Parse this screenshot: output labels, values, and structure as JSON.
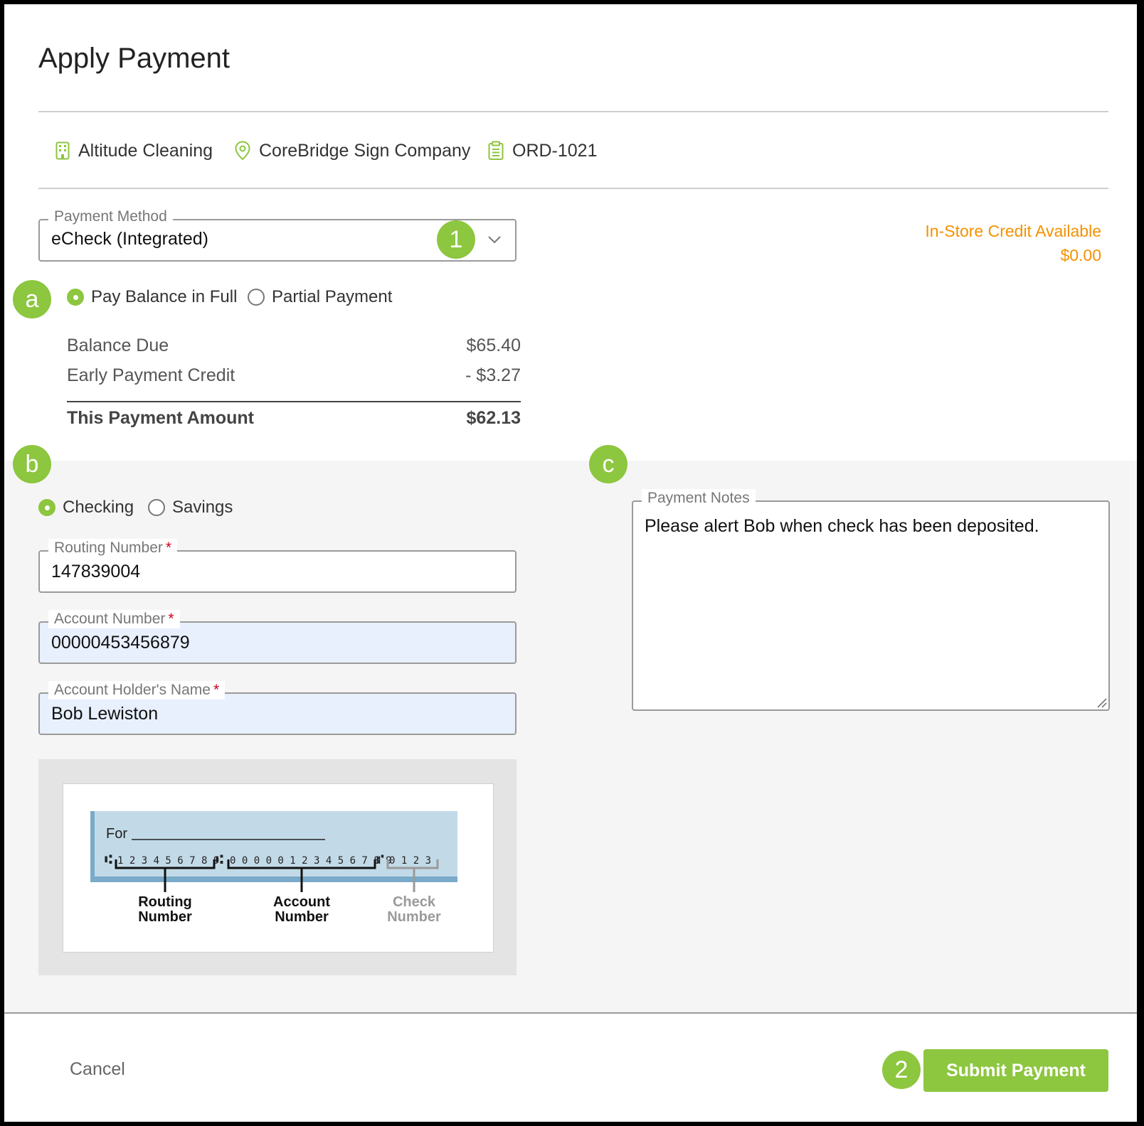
{
  "dialog": {
    "title": "Apply Payment"
  },
  "info": {
    "customer": "Altitude Cleaning",
    "location": "CoreBridge Sign Company",
    "order": "ORD-1021"
  },
  "payment_method": {
    "label": "Payment Method",
    "value": "eCheck (Integrated)",
    "badge": "1"
  },
  "credit": {
    "label": "In-Store Credit Available",
    "amount": "$0.00",
    "color": "#f39200"
  },
  "payment_type": {
    "badge": "a",
    "options": [
      "Pay Balance in Full",
      "Partial Payment"
    ],
    "selected": "Pay Balance in Full"
  },
  "summary": {
    "balance_due_label": "Balance Due",
    "balance_due": "$65.40",
    "early_credit_label": "Early Payment Credit",
    "early_credit": "- $3.27",
    "total_label": "This Payment Amount",
    "total": "$62.13"
  },
  "account": {
    "badge": "b",
    "types": [
      "Checking",
      "Savings"
    ],
    "selected": "Checking",
    "routing_label": "Routing Number",
    "routing_value": "147839004",
    "account_label": "Account Number",
    "account_value": "00000453456879",
    "holder_label": "Account Holder's Name",
    "holder_value": "Bob Lewiston",
    "required_mark": "*"
  },
  "check_image": {
    "for_label": "For",
    "micr_routing": "1 2 3 4 5 6 7 8 9",
    "micr_account": "0 0 0 0 0 1 2 3 4 5 6 7 8 9",
    "micr_check": "0 1 2 3",
    "routing_caption": [
      "Routing",
      "Number"
    ],
    "account_caption": [
      "Account",
      "Number"
    ],
    "check_caption": [
      "Check",
      "Number"
    ]
  },
  "notes": {
    "badge": "c",
    "label": "Payment Notes",
    "value": "Please alert Bob when check has been deposited."
  },
  "footer": {
    "cancel_label": "Cancel",
    "submit_label": "Submit Payment",
    "badge": "2"
  },
  "colors": {
    "accent": "#8dc63f",
    "credit": "#f39200",
    "required": "#d0021b",
    "autofill": "#e8f0fe"
  }
}
